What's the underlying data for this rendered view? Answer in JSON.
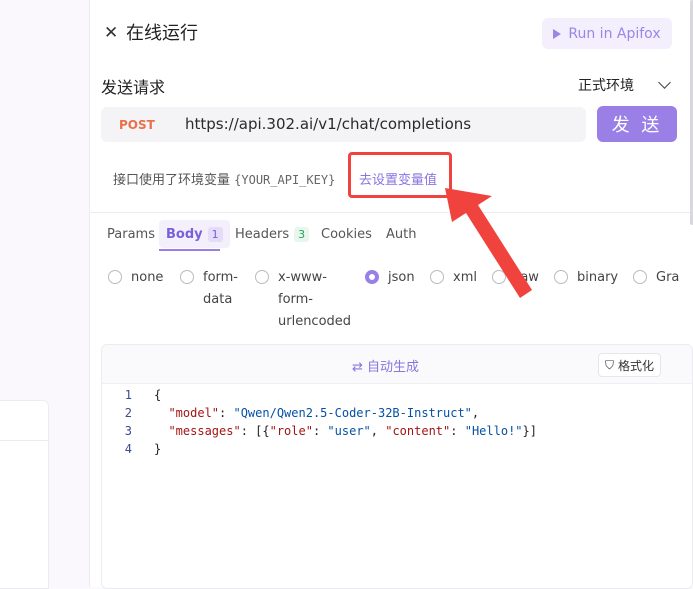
{
  "window": {
    "title": "在线运行",
    "run_button": "Run in Apifox"
  },
  "request": {
    "section_title": "发送请求",
    "environment": "正式环境",
    "method": "POST",
    "url": "https://api.302.ai/v1/chat/completions",
    "send_label": "发 送",
    "env_note": "接口使用了环境变量",
    "env_var": "{YOUR_API_KEY}",
    "set_var_link": "去设置变量值"
  },
  "tabs": [
    {
      "label": "Params"
    },
    {
      "label": "Body",
      "badge": "1"
    },
    {
      "label": "Headers",
      "badge": "3"
    },
    {
      "label": "Cookies"
    },
    {
      "label": "Auth"
    }
  ],
  "body_types": [
    "none",
    "form-data",
    "x-www-form-urlencoded",
    "json",
    "xml",
    "raw",
    "binary",
    "GraphQL"
  ],
  "body_type_lines": {
    "form_data": [
      "form-",
      "data"
    ],
    "urlencoded": [
      "x-www-",
      "form-",
      "urlencoded"
    ],
    "graphql_visible": "Gra"
  },
  "selected_body_type": "json",
  "editor": {
    "autogen_label": "自动生成",
    "format_label": "格式化",
    "lines": [
      {
        "n": "1",
        "text": "{"
      },
      {
        "n": "2",
        "key": "\"model\"",
        "value": "\"Qwen/Qwen2.5-Coder-32B-Instruct\""
      },
      {
        "n": "3",
        "key": "\"messages\"",
        "value_prefix": ": [{",
        "k1": "\"role\"",
        "v1": "\"user\"",
        "k2": "\"content\"",
        "v2": "\"Hello!\"",
        "suffix": "}]"
      },
      {
        "n": "4",
        "text": "}"
      }
    ]
  },
  "colors": {
    "accent": "#9a7fe6",
    "method": "#e9704a",
    "annotation": "#f0433d"
  },
  "icons": [
    "close-icon",
    "play-icon",
    "chevron-down-icon",
    "refresh-icon",
    "format-icon",
    "annotation-arrow"
  ]
}
